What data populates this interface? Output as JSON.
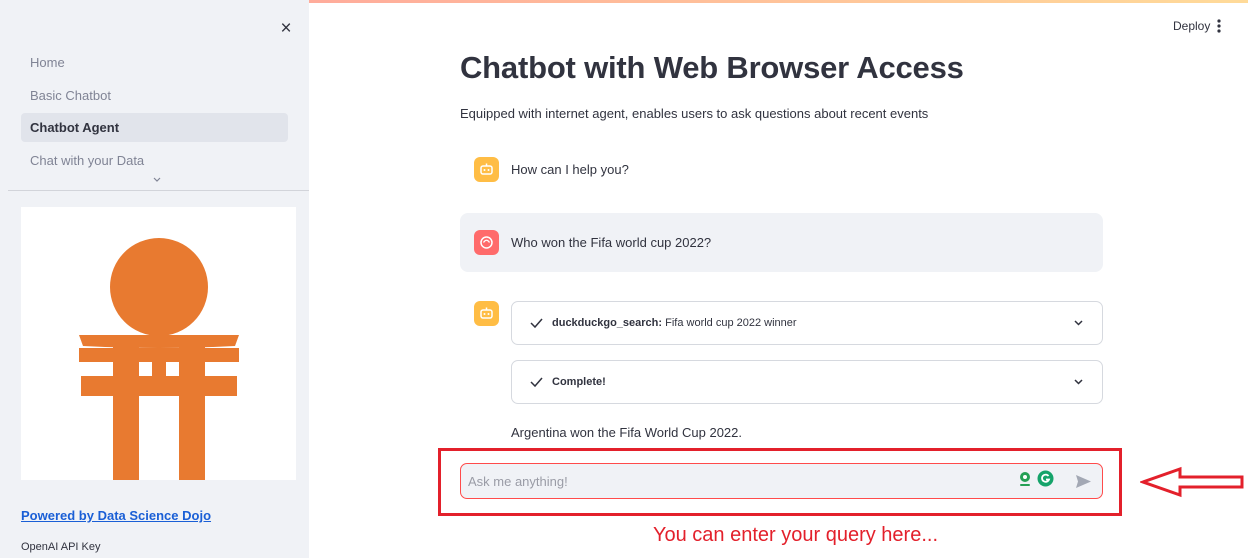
{
  "sidebar": {
    "close_label": "×",
    "nav": [
      {
        "label": "Home",
        "active": false
      },
      {
        "label": "Basic Chatbot",
        "active": false
      },
      {
        "label": "Chatbot Agent",
        "active": true
      },
      {
        "label": "Chat with your Data",
        "active": false
      }
    ],
    "expand_icon": "chevron-down-icon",
    "logo": {
      "name": "data-science-dojo-torii-logo",
      "color": "#e87a30"
    },
    "powered_by_label": "Powered by Data Science Dojo",
    "api_key_label": "OpenAI API Key"
  },
  "header": {
    "deploy_label": "Deploy",
    "menu_icon": "kebab-menu-icon"
  },
  "main": {
    "title": "Chatbot with Web Browser Access",
    "subtitle": "Equipped with internet agent, enables users to ask questions about recent events",
    "messages": [
      {
        "role": "assistant",
        "avatar": "bot-icon",
        "text": "How can I help you?"
      },
      {
        "role": "user",
        "avatar": "user-face-icon",
        "text": "Who won the Fifa world cup 2022?"
      },
      {
        "role": "assistant",
        "avatar": "bot-icon",
        "steps": [
          {
            "status_icon": "check-icon",
            "tool": "duckduckgo_search:",
            "query": "Fifa world cup 2022 winner",
            "expand_icon": "chevron-down-icon"
          },
          {
            "status_icon": "check-icon",
            "tool": "Complete!",
            "query": "",
            "expand_icon": "chevron-down-icon"
          }
        ],
        "text": "Argentina won the Fifa World Cup 2022."
      }
    ]
  },
  "chat_input": {
    "placeholder": "Ask me anything!",
    "value": "",
    "extension_icons": [
      "location-pin-icon",
      "grammarly-icon"
    ],
    "send_icon": "send-icon"
  },
  "annotation": {
    "caption": "You can enter your query here...",
    "color": "#e3202b",
    "arrow_icon": "left-arrow-icon"
  },
  "colors": {
    "primary": "#ff4b4b",
    "sidebar_bg": "#f0f2f6",
    "bot_avatar": "#ffbd45",
    "user_avatar": "#ff6b6b",
    "link": "#1a5fd6"
  }
}
